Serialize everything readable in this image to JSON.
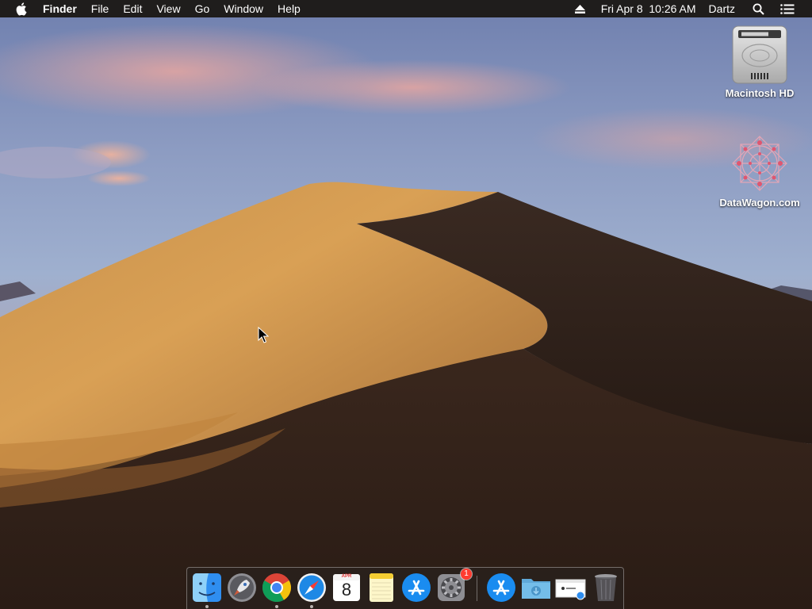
{
  "menubar": {
    "app_name": "Finder",
    "menus": [
      "File",
      "Edit",
      "View",
      "Go",
      "Window",
      "Help"
    ],
    "clock": "Fri Apr 8  10:26 AM",
    "user": "Dartz",
    "icons": [
      "apple-logo",
      "eject-icon",
      "spotlight-search-icon",
      "notification-center-icon"
    ]
  },
  "desktop_icons": [
    {
      "label": "Macintosh HD",
      "icon": "hard-drive-icon"
    },
    {
      "label": "DataWagon.com",
      "icon": "datawagon-logo-icon"
    }
  ],
  "dock": {
    "items": [
      {
        "name": "finder",
        "icon": "finder-icon",
        "running": true
      },
      {
        "name": "launchpad",
        "icon": "launchpad-rocket-icon",
        "running": false
      },
      {
        "name": "chrome",
        "icon": "chrome-icon",
        "running": true
      },
      {
        "name": "safari",
        "icon": "safari-compass-icon",
        "running": true
      },
      {
        "name": "calendar",
        "icon": "calendar-icon",
        "running": false,
        "month": "APR",
        "day": "8"
      },
      {
        "name": "notes",
        "icon": "notes-icon",
        "running": false
      },
      {
        "name": "app-store",
        "icon": "app-store-icon",
        "running": false
      },
      {
        "name": "system-preferences",
        "icon": "gear-icon",
        "running": false,
        "badge": "1"
      },
      {
        "name": "applications-stack",
        "icon": "app-store-stack-icon",
        "running": false
      },
      {
        "name": "downloads-folder",
        "icon": "downloads-folder-icon",
        "running": false
      },
      {
        "name": "document-stack",
        "icon": "document-stack-icon",
        "running": false
      },
      {
        "name": "trash",
        "icon": "trash-icon",
        "running": false
      }
    ]
  },
  "colors": {
    "menubar_bg": "#1f1d1c",
    "badge_red": "#ff3b30",
    "sky_top": "#7f8fb8",
    "dune_light": "#d39a4e",
    "dune_dark": "#2e1f17"
  }
}
